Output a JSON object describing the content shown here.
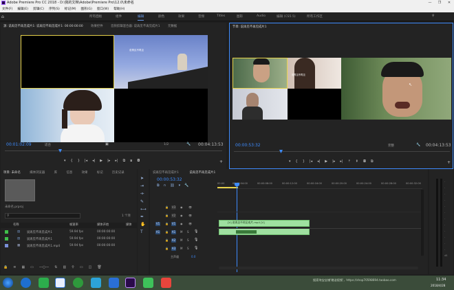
{
  "window": {
    "title": "Adobe Premiere Pro CC 2018 - D:\\我的文档\\Adobe\\Premiere Pro\\12.0\\未命名",
    "controls": [
      "—",
      "❐",
      "✕"
    ]
  },
  "menu": [
    "文件(F)",
    "编辑(E)",
    "剪辑(C)",
    "序列(S)",
    "标记(M)",
    "图形(G)",
    "窗口(W)",
    "帮助(H)"
  ],
  "workspaces": {
    "items": [
      "所有面板",
      "组件",
      "编辑",
      "颜色",
      "效果",
      "音频",
      "Titles",
      "图形",
      "Audio",
      "编辑 (CS5.5)",
      "所有工作区"
    ],
    "active": "编辑"
  },
  "source_panel": {
    "tabs": [
      "源: 说再见不再见成片1: 说再见不再见成片1: 00:00:00:00",
      "效果控件",
      "音频剪辑混合器: 说再见不再见成片1",
      "元数据"
    ],
    "timecode": "00:01:02:09",
    "fit": "适合",
    "ratio": "1/2",
    "duration": "00:04:13:53",
    "video_caption": "说再见不再见"
  },
  "program_panel": {
    "tab": "节目: 说再见不再见成片1",
    "timecode": "00:00:53:32",
    "fit": "完整",
    "duration": "00:04:13:53",
    "video_caption": "说再见不再见"
  },
  "project_panel": {
    "tabs": [
      "项目: 未命名",
      "媒体浏览器",
      "库",
      "信息",
      "效果",
      "标记",
      "历史记录"
    ],
    "file": "未命名.prproj",
    "item_count": "1 个项",
    "search_placeholder": "",
    "columns": [
      "名称",
      "帧速率",
      "媒体开始",
      "媒体"
    ],
    "rows": [
      {
        "color": "#3fbf4a",
        "name": "说再见不再见成片1",
        "fps": "59.94 fps",
        "start": "00:00:00:00"
      },
      {
        "color": "#3fbf4a",
        "name": "说再见不再见成片1",
        "fps": "59.94 fps",
        "start": "00:00:00:00"
      },
      {
        "color": "#7a8fd8",
        "name": "说再见不再见成片1.mp4",
        "fps": "59.94 fps",
        "start": "00:00:00:00"
      }
    ]
  },
  "timeline_panel": {
    "tabs": [
      "说再见不再见成片1",
      "说再见不再见成片1"
    ],
    "timecode": "00:00:53:32",
    "ruler": [
      "00:00",
      "00:00:04:00",
      "00:00:08:00",
      "00:00:12:00",
      "00:00:16:00",
      "00:00:20:00",
      "00:00:24:00",
      "00:00:28:00",
      "00:00:32:00"
    ],
    "video_tracks": [
      "V3",
      "V2",
      "V1"
    ],
    "audio_tracks": [
      "A1",
      "A2",
      "A3"
    ],
    "master": "主声道",
    "master_value": "0.0",
    "clip_video_label": "[V] 说再见不再见成片.mp4 [V]",
    "clip_audio_label": ""
  },
  "taskbar": {
    "time": "11:34",
    "date": "2018/4/28",
    "watermark": "搜索淘宝店铺'赠送视频'，https://shop70598694.taobao.com"
  },
  "colors": {
    "accent": "#3e8cff",
    "clip_green": "#9fe0a0",
    "selection": "#e6d24a"
  }
}
